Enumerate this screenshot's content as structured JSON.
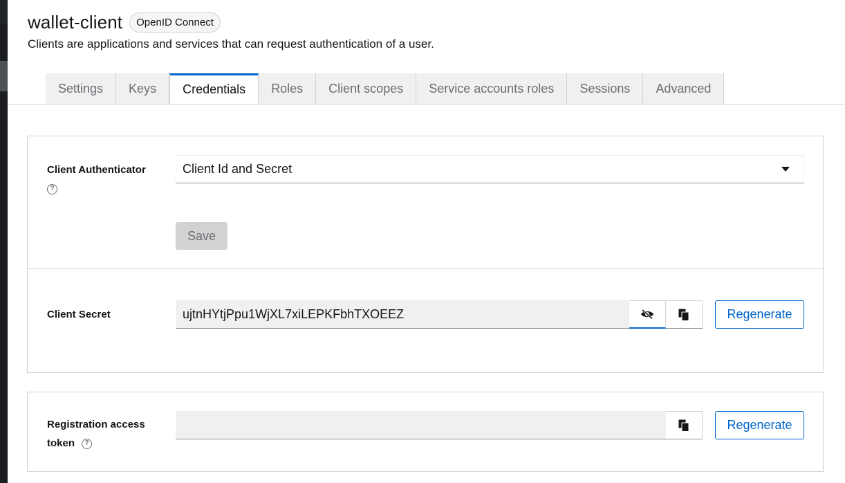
{
  "header": {
    "title": "wallet-client",
    "badge": "OpenID Connect",
    "subtitle": "Clients are applications and services that can request authentication of a user."
  },
  "tabs": [
    {
      "label": "Settings",
      "active": false
    },
    {
      "label": "Keys",
      "active": false
    },
    {
      "label": "Credentials",
      "active": true
    },
    {
      "label": "Roles",
      "active": false
    },
    {
      "label": "Client scopes",
      "active": false
    },
    {
      "label": "Service accounts roles",
      "active": false
    },
    {
      "label": "Sessions",
      "active": false
    },
    {
      "label": "Advanced",
      "active": false
    }
  ],
  "credentials": {
    "authenticator_label": "Client Authenticator",
    "authenticator_value": "Client Id and Secret",
    "save_label": "Save",
    "secret_label": "Client Secret",
    "secret_value": "ujtnHYtjPpu1WjXL7xiLEPKFbhTXOEEZ",
    "regenerate_label": "Regenerate",
    "token_label_line1": "Registration access",
    "token_label_line2": "token",
    "token_value": "",
    "token_regenerate_label": "Regenerate"
  },
  "icons": {
    "help": "help-circle-icon",
    "caret": "caret-down-icon",
    "eye": "eye-slash-icon",
    "copy": "copy-icon"
  },
  "colors": {
    "accent": "#0066cc",
    "disabled_button": "#d2d2d2",
    "input_bg": "#f0f0f0"
  }
}
